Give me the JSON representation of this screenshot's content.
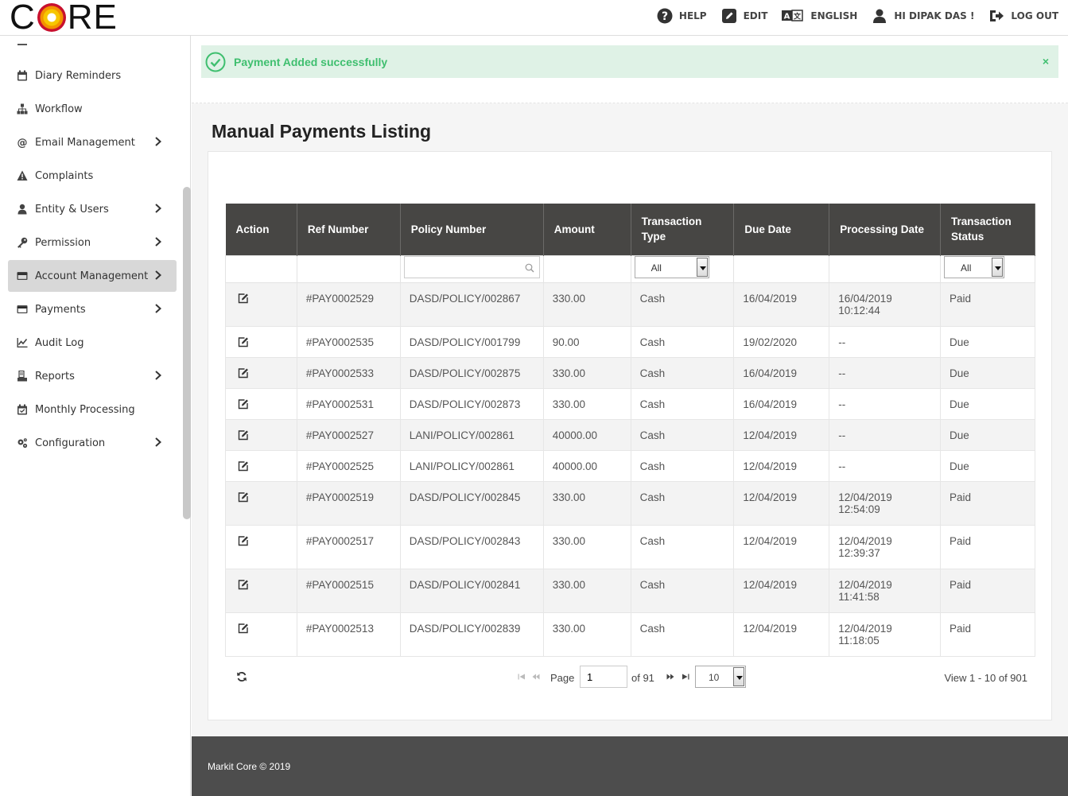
{
  "brand": {
    "logo_text_left": "C",
    "logo_text_right": "RE"
  },
  "topbar": {
    "help": "HELP",
    "edit": "EDIT",
    "language": "ENGLISH",
    "user": "HI DIPAK DAS !",
    "logout": "LOG OUT"
  },
  "sidebar": {
    "items": [
      {
        "label": "Diary Reminders",
        "icon": "calendar-icon",
        "has_submenu": false,
        "active": false
      },
      {
        "label": "Workflow",
        "icon": "sitemap-icon",
        "has_submenu": false,
        "active": false
      },
      {
        "label": "Email Management",
        "icon": "at-icon",
        "has_submenu": true,
        "active": false
      },
      {
        "label": "Complaints",
        "icon": "warning-icon",
        "has_submenu": false,
        "active": false
      },
      {
        "label": "Entity & Users",
        "icon": "user-icon",
        "has_submenu": true,
        "active": false
      },
      {
        "label": "Permission",
        "icon": "key-icon",
        "has_submenu": true,
        "active": false
      },
      {
        "label": "Account Management",
        "icon": "credit-card-icon",
        "has_submenu": true,
        "active": true
      },
      {
        "label": "Payments",
        "icon": "credit-card-icon",
        "has_submenu": true,
        "active": false
      },
      {
        "label": "Audit Log",
        "icon": "line-chart-icon",
        "has_submenu": false,
        "active": false
      },
      {
        "label": "Reports",
        "icon": "reports-icon",
        "has_submenu": true,
        "active": false
      },
      {
        "label": "Monthly Processing",
        "icon": "calendar-check-icon",
        "has_submenu": false,
        "active": false
      },
      {
        "label": "Configuration",
        "icon": "gears-icon",
        "has_submenu": true,
        "active": false
      }
    ]
  },
  "alert": {
    "message": "Payment Added successfully",
    "close": "×",
    "color": "#3fbf6f"
  },
  "page": {
    "title": "Manual Payments Listing"
  },
  "table": {
    "columns": [
      "Action",
      "Ref Number",
      "Policy Number",
      "Amount",
      "Transaction Type",
      "Due Date",
      "Processing Date",
      "Transaction Status"
    ],
    "filters": {
      "policy_search_value": "",
      "transaction_type": "All",
      "transaction_status": "All"
    },
    "rows": [
      {
        "ref": "#PAY0002529",
        "policy": "DASD/POLICY/002867",
        "amount": "330.00",
        "type": "Cash",
        "due": "16/04/2019",
        "proc_date": "16/04/2019",
        "proc_time": "10:12:44",
        "status": "Paid"
      },
      {
        "ref": "#PAY0002535",
        "policy": "DASD/POLICY/001799",
        "amount": "90.00",
        "type": "Cash",
        "due": "19/02/2020",
        "proc_date": "--",
        "proc_time": "",
        "status": "Due"
      },
      {
        "ref": "#PAY0002533",
        "policy": "DASD/POLICY/002875",
        "amount": "330.00",
        "type": "Cash",
        "due": "16/04/2019",
        "proc_date": "--",
        "proc_time": "",
        "status": "Due"
      },
      {
        "ref": "#PAY0002531",
        "policy": "DASD/POLICY/002873",
        "amount": "330.00",
        "type": "Cash",
        "due": "16/04/2019",
        "proc_date": "--",
        "proc_time": "",
        "status": "Due"
      },
      {
        "ref": "#PAY0002527",
        "policy": "LANI/POLICY/002861",
        "amount": "40000.00",
        "type": "Cash",
        "due": "12/04/2019",
        "proc_date": "--",
        "proc_time": "",
        "status": "Due"
      },
      {
        "ref": "#PAY0002525",
        "policy": "LANI/POLICY/002861",
        "amount": "40000.00",
        "type": "Cash",
        "due": "12/04/2019",
        "proc_date": "--",
        "proc_time": "",
        "status": "Due"
      },
      {
        "ref": "#PAY0002519",
        "policy": "DASD/POLICY/002845",
        "amount": "330.00",
        "type": "Cash",
        "due": "12/04/2019",
        "proc_date": "12/04/2019",
        "proc_time": "12:54:09",
        "status": "Paid"
      },
      {
        "ref": "#PAY0002517",
        "policy": "DASD/POLICY/002843",
        "amount": "330.00",
        "type": "Cash",
        "due": "12/04/2019",
        "proc_date": "12/04/2019",
        "proc_time": "12:39:37",
        "status": "Paid"
      },
      {
        "ref": "#PAY0002515",
        "policy": "DASD/POLICY/002841",
        "amount": "330.00",
        "type": "Cash",
        "due": "12/04/2019",
        "proc_date": "12/04/2019",
        "proc_time": "11:41:58",
        "status": "Paid"
      },
      {
        "ref": "#PAY0002513",
        "policy": "DASD/POLICY/002839",
        "amount": "330.00",
        "type": "Cash",
        "due": "12/04/2019",
        "proc_date": "12/04/2019",
        "proc_time": "11:18:05",
        "status": "Paid"
      }
    ]
  },
  "pager": {
    "page_label": "Page",
    "current_page": "1",
    "of_label": "of 91",
    "page_size": "10",
    "view_text": "View 1 - 10 of 901"
  },
  "footer": {
    "text": "Markit Core © 2019"
  }
}
